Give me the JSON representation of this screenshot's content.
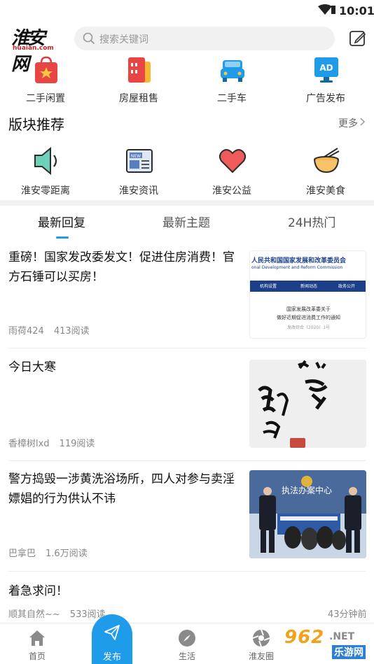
{
  "status_bar": {
    "time": "10:01"
  },
  "header": {
    "logo_text": "淮安网",
    "logo_domain": "huaian.com",
    "search_placeholder": "搜索关键词"
  },
  "quick_links": [
    {
      "label": "二手闲置",
      "icon": "shopping-bag-icon"
    },
    {
      "label": "房屋租售",
      "icon": "cards-icon"
    },
    {
      "label": "二手车",
      "icon": "car-icon"
    },
    {
      "label": "广告发布",
      "icon": "ad-icon"
    }
  ],
  "section": {
    "title": "版块推荐",
    "more": "更多"
  },
  "boards": [
    {
      "label": "淮安零距离",
      "icon": "speaker-icon"
    },
    {
      "label": "淮安资讯",
      "icon": "newspaper-icon"
    },
    {
      "label": "淮安公益",
      "icon": "heart-icon"
    },
    {
      "label": "淮安美食",
      "icon": "bowl-icon"
    }
  ],
  "tabs": [
    {
      "label": "最新回复",
      "active": true
    },
    {
      "label": "最新主题",
      "active": false
    },
    {
      "label": "24H热门",
      "active": false
    }
  ],
  "posts": [
    {
      "title": "重磅！国家发改委发文！促进住房消费！官方石锤可以买房！",
      "author": "雨荷424",
      "reads": "413阅读",
      "thumb": {
        "org_name": "人民共和国国家发展和改革委员会",
        "org_en": "onal Development and Reform Commission",
        "nav": [
          "机构设置",
          "新闻动态",
          "政务公开"
        ],
        "doc_title_1": "国家发展改革委关于",
        "doc_title_2": "做好近期促进消费工作的通知",
        "doc_no": "发改综合〔2020〕1号"
      }
    },
    {
      "title": "今日大寒",
      "author": "香樟树lxd",
      "reads": "119阅读"
    },
    {
      "title": "警方捣毁一涉黄洗浴场所，四人对参与卖淫嫖娼的行为供认不讳",
      "author": "巴拿巴",
      "reads": "1.6万阅读",
      "thumb": {
        "sign": "执法办案中心"
      }
    },
    {
      "title": "着急求问！",
      "author": "顺其自然~~",
      "reads": "533阅读",
      "time": "43分钟前"
    }
  ],
  "bottom_nav": [
    {
      "label": "首页",
      "icon": "home-icon"
    },
    {
      "label": "发布",
      "icon": "paper-plane-icon"
    },
    {
      "label": "生活",
      "icon": "compass-icon"
    },
    {
      "label": "淮友圈",
      "icon": "aperture-icon"
    }
  ],
  "watermark": {
    "brand": "962",
    "domain": ".NET",
    "name": "乐游网"
  },
  "colors": {
    "accent": "#1e9be9",
    "red": "#e23b3b"
  }
}
